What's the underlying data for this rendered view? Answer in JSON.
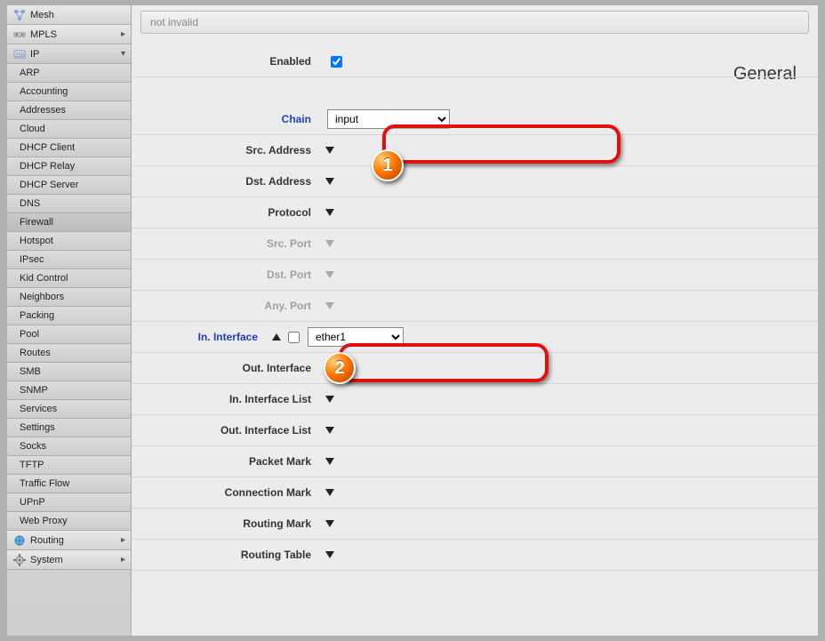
{
  "sidebar": {
    "top": [
      {
        "icon": "mesh-icon",
        "label": "Mesh"
      },
      {
        "icon": "mpls-icon",
        "label": "MPLS",
        "arrow": "right"
      },
      {
        "icon": "ip-icon",
        "label": "IP",
        "arrow": "down",
        "expanded": true
      }
    ],
    "ip_submenu": [
      "ARP",
      "Accounting",
      "Addresses",
      "Cloud",
      "DHCP Client",
      "DHCP Relay",
      "DHCP Server",
      "DNS",
      "Firewall",
      "Hotspot",
      "IPsec",
      "Kid Control",
      "Neighbors",
      "Packing",
      "Pool",
      "Routes",
      "SMB",
      "SNMP",
      "Services",
      "Settings",
      "Socks",
      "TFTP",
      "Traffic Flow",
      "UPnP",
      "Web Proxy"
    ],
    "ip_selected": "Firewall",
    "bottom": [
      {
        "icon": "routing-icon",
        "label": "Routing",
        "arrow": "right"
      },
      {
        "icon": "system-icon",
        "label": "System",
        "arrow": "right"
      }
    ]
  },
  "breadcrumb": "not invalid",
  "section_title": "General",
  "callouts": {
    "one": "1",
    "two": "2"
  },
  "fields": {
    "enabled": {
      "label": "Enabled",
      "checked": true
    },
    "chain": {
      "label": "Chain",
      "value": "input"
    },
    "src_address": {
      "label": "Src. Address"
    },
    "dst_address": {
      "label": "Dst. Address"
    },
    "protocol": {
      "label": "Protocol"
    },
    "src_port": {
      "label": "Src. Port"
    },
    "dst_port": {
      "label": "Dst. Port"
    },
    "any_port": {
      "label": "Any. Port"
    },
    "in_interface": {
      "label": "In. Interface",
      "neg": false,
      "value": "ether1"
    },
    "out_interface": {
      "label": "Out. Interface"
    },
    "in_interface_list": {
      "label": "In. Interface List"
    },
    "out_interface_list": {
      "label": "Out. Interface List"
    },
    "packet_mark": {
      "label": "Packet Mark"
    },
    "connection_mark": {
      "label": "Connection Mark"
    },
    "routing_mark": {
      "label": "Routing Mark"
    },
    "routing_table": {
      "label": "Routing Table"
    }
  }
}
